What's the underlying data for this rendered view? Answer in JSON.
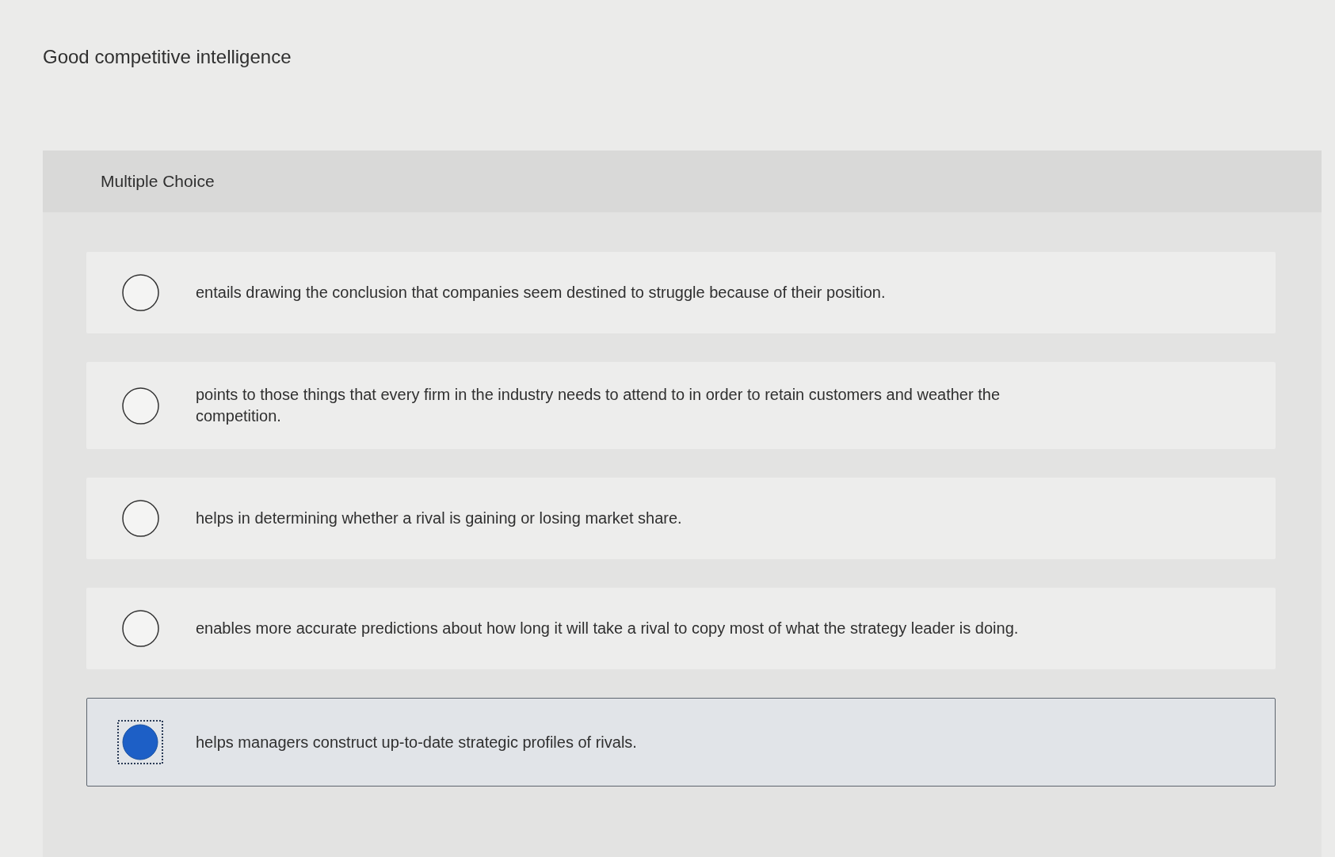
{
  "question": {
    "text": "Good competitive intelligence"
  },
  "panel": {
    "type_label": "Multiple Choice"
  },
  "options": [
    {
      "text": "entails drawing the conclusion that companies seem destined to struggle because of their position.",
      "selected": false
    },
    {
      "text": "points to those things that every firm in the industry needs to attend to in order to retain customers and weather the competition.",
      "selected": false
    },
    {
      "text": "helps in determining whether a rival is gaining or losing market share.",
      "selected": false
    },
    {
      "text": "enables more accurate predictions about how long it will take a rival to copy most of what the strategy leader is doing.",
      "selected": false
    },
    {
      "text": "helps managers construct up-to-date strategic profiles of rivals.",
      "selected": true
    }
  ]
}
